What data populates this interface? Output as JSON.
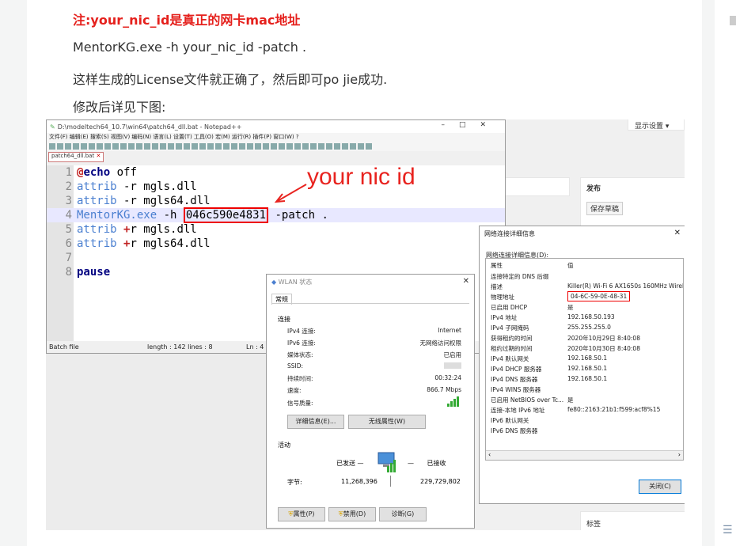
{
  "article": {
    "note": "注:your_nic_id是真正的网卡mac地址",
    "command": "MentorKG.exe -h your_nic_id -patch .",
    "line2": "这样生成的License文件就正确了，然后即可po jie成功.",
    "line3": "修改后详见下图:"
  },
  "blog": {
    "display_btn": "显示设置 ▾",
    "publish_title": "发布",
    "save_draft": "保存草稿",
    "tags": "标签"
  },
  "notepad": {
    "title": "D:\\modeltech64_10.7\\win64\\patch64_dll.bat - Notepad++",
    "menu": "文件(F)  编辑(E)  搜索(S)  视图(V)  编码(N)  语言(L)  设置(T)  工具(O)  宏(M)  运行(R)  插件(P)  窗口(W)  ?",
    "tab": "patch64_dll.bat",
    "lines": [
      {
        "n": "1",
        "t": "@echo off"
      },
      {
        "n": "2",
        "t": "attrib -r mgls.dll"
      },
      {
        "n": "3",
        "t": "attrib -r mgls64.dll"
      },
      {
        "n": "4",
        "t": "MentorKG.exe -h 046c590e4831 -patch ."
      },
      {
        "n": "5",
        "t": "attrib +r mgls.dll"
      },
      {
        "n": "6",
        "t": "attrib +r mgls64.dll"
      },
      {
        "n": "7",
        "t": ""
      },
      {
        "n": "8",
        "t": "pause"
      }
    ],
    "nic_id": "046c590e4831",
    "status_left": "Batch file",
    "status_mid": "length : 142    lines : 8",
    "status_right": "Ln : 4",
    "annotation": "your nic id"
  },
  "network": {
    "title": "网络连接详细信息",
    "subtitle": "网络连接详细信息(D):",
    "header_prop": "属性",
    "header_val": "值",
    "rows": [
      {
        "p": "连接特定的 DNS 后缀",
        "v": ""
      },
      {
        "p": "描述",
        "v": "Killer(R) Wi-Fi 6 AX1650s 160MHz Wirel"
      },
      {
        "p": "物理地址",
        "v": "04-6C-59-0E-48-31"
      },
      {
        "p": "已启用 DHCP",
        "v": "是"
      },
      {
        "p": "IPv4 地址",
        "v": "192.168.50.193"
      },
      {
        "p": "IPv4 子网掩码",
        "v": "255.255.255.0"
      },
      {
        "p": "获得租约的时间",
        "v": "2020年10月29日 8:40:08"
      },
      {
        "p": "租约过期的时间",
        "v": "2020年10月30日 8:40:08"
      },
      {
        "p": "IPv4 默认网关",
        "v": "192.168.50.1"
      },
      {
        "p": "IPv4 DHCP 服务器",
        "v": "192.168.50.1"
      },
      {
        "p": "IPv4 DNS 服务器",
        "v": "192.168.50.1"
      },
      {
        "p": "IPv4 WINS 服务器",
        "v": ""
      },
      {
        "p": "已启用 NetBIOS over Tc...",
        "v": "是"
      },
      {
        "p": "连接-本地 IPv6 地址",
        "v": "fe80::2163:21b1:f599:acf8%15"
      },
      {
        "p": "IPv6 默认网关",
        "v": ""
      },
      {
        "p": "IPv6 DNS 服务器",
        "v": ""
      }
    ],
    "close": "关闭(C)"
  },
  "wlan": {
    "title": "WLAN 状态",
    "tab": "常规",
    "section_conn": "连接",
    "rows": [
      {
        "p": "IPv4 连接:",
        "v": "Internet"
      },
      {
        "p": "IPv6 连接:",
        "v": "无网络访问权限"
      },
      {
        "p": "媒体状态:",
        "v": "已启用"
      },
      {
        "p": "SSID:",
        "v": ""
      },
      {
        "p": "持续时间:",
        "v": "00:32:24"
      },
      {
        "p": "速度:",
        "v": "866.7 Mbps"
      },
      {
        "p": "信号质量:",
        "v": ""
      }
    ],
    "details_btn": "详细信息(E)...",
    "wireless_btn": "无线属性(W)",
    "section_activity": "活动",
    "sent": "已发送",
    "received": "已接收",
    "bytes_label": "字节:",
    "bytes_sent": "11,268,396",
    "bytes_recv": "229,729,802",
    "props_btn": "属性(P)",
    "disable_btn": "禁用(D)",
    "diagnose_btn": "诊断(G)"
  }
}
